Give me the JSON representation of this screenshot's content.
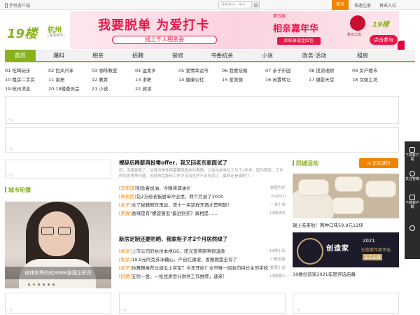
{
  "topbar": {
    "mobile": "手机客户端",
    "search_placeholder": "搜索帖子、用户...",
    "home": "首页",
    "register": "快速注册",
    "login": "再来入坑"
  },
  "header": {
    "logo": "19楼",
    "city": "杭州",
    "city_switch": "[其他城市]",
    "banner": {
      "slogan": "我要脱单 为爱打卡",
      "sub": "线上千人相亲会",
      "party_badge": "第五届",
      "party": "相亲嘉年华",
      "reward": "回帖享现金红包",
      "org": "杭州工会",
      "mini_logo": "19楼",
      "join": "点击参与"
    }
  },
  "nav": [
    "首页",
    "爆料",
    "相亲",
    "招聘",
    "装修",
    "书香杭关",
    "小说",
    "政务·活动",
    "租房"
  ],
  "forums": [
    "01 吃喝玩乐",
    "02 拉风汽车",
    "03 咖啡教室",
    "04 温柔乡",
    "05 爱情幸运号",
    "06 我要结婚",
    "07 亲子乐园",
    "08 投资理财",
    "09 房产楼市",
    "10 租房二手房",
    "11 家居",
    "12 教育",
    "13 求职",
    "14 健康公社",
    "15 爱美丽",
    "16 闲置转让",
    "17 摄影天堂",
    "18 文娱工坊",
    "19 杭州消息",
    "20 19楼委员会",
    "21 小说",
    "22 阅读"
  ],
  "ad_tag": "广告",
  "sidebar_right": [
    {
      "label": "下载客户端",
      "icon": "phone-icon"
    },
    {
      "label": "关注官微",
      "icon": "weibo-icon"
    },
    {
      "label": "下载客户端",
      "icon": "download-icon"
    },
    {
      "label": "客服",
      "icon": "headset-icon"
    }
  ],
  "carousel": {
    "title": "城市轮播",
    "caption": "自律优秀的杭州MM是国企职员",
    "slides": 6,
    "active": 1
  },
  "news": {
    "headline1": "裸辞后降薪再投零offer，我又回老东家面试了",
    "summary": "哎，没错是我了，这真的是件很需要厚脸皮的事情。之前在前单位工作了2年多，因为薪资、工作的内容等等问题，觉得再在那份工作中没法也学不到东西了，最终还是离职了...",
    "items1": [
      {
        "cat": "[孕知道]",
        "title": "别急着加油，今晚将调油价",
        "author": "章程大忙"
      },
      {
        "cat": "[帮帮团]",
        "title": "花2万给老板厨单冲业绩，两个月退了3000",
        "author": "XS0810"
      },
      {
        "cat": "[亲子]",
        "title": "全了秘籍明年再战，双十一买这样东西才是明智！",
        "author": "一本小本"
      },
      {
        "cat": "[美食]",
        "title": "香辣是有\"螺旋菌虫\"最近别买？真相是......",
        "author": "19楼林志"
      }
    ],
    "headline2": "新房定制还要防晒，我家柜子才2个月居然绿了",
    "items2": [
      {
        "cat": "[相亲]",
        "title": "上市公司的杭州本地GG，阳光爱笑眼神很温柔",
        "author": "19楼小红"
      },
      {
        "cat": "[秒杀]",
        "title": "19.9元阿克苏冰糖心，产自红旗坡，香飘数甜全有了",
        "author": "小骰色胎"
      },
      {
        "cat": "[亲子]",
        "title": "你舞舞推荐过胡瓜上学军？今年开始？全市唯一招收向特长生的学校",
        "author": "智慧小远"
      },
      {
        "cat": "[招聘]",
        "title": "五险一金，一批优质会计财务工作推荐，速来！",
        "author": "19楼楼小"
      }
    ]
  },
  "activity": {
    "title": "同城活动",
    "button": "正在进行",
    "item1": "瑞士卷来啦！两种口味59.9元12块",
    "item2": "19楼创造家2021年度评选启幕",
    "banner2": {
      "t1": "创造家",
      "t2": "2021",
      "t3": "创造家年度评选",
      "t4": "正式启幕"
    }
  },
  "colors": {
    "brand_green": "#8ab21f",
    "accent_orange": "#f08300",
    "banner_red": "#e6194b"
  }
}
